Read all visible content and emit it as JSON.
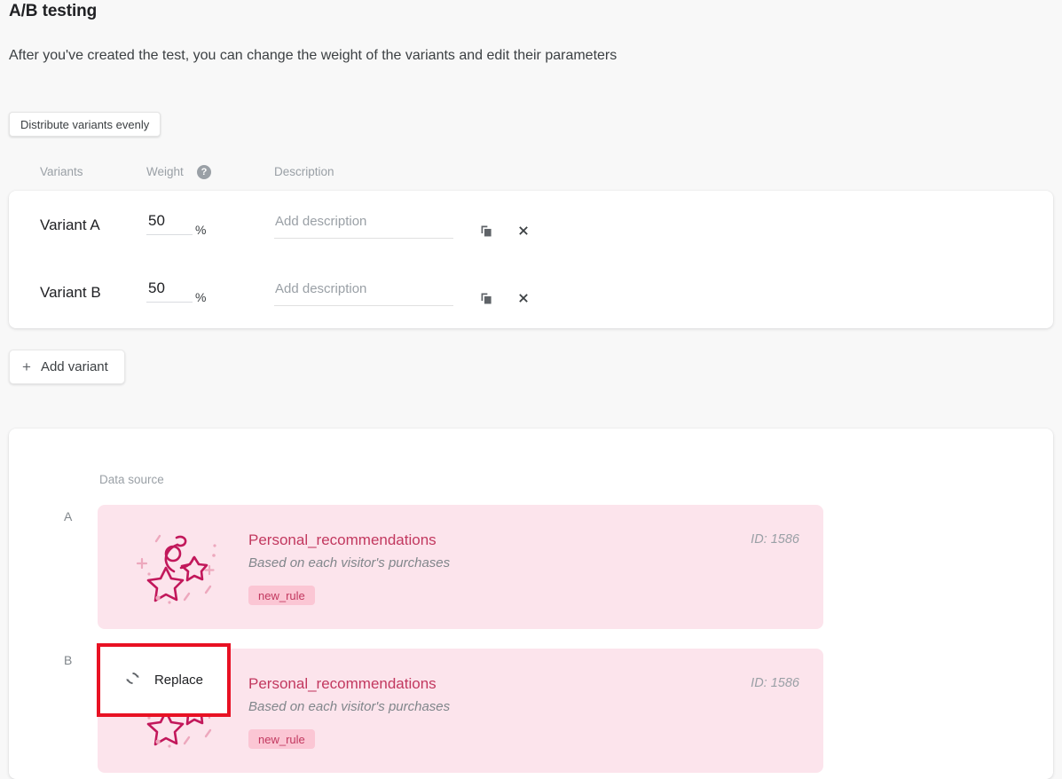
{
  "header": {
    "title": "A/B testing",
    "subtitle": "After you've created the test, you can change the weight of the variants and edit their parameters"
  },
  "toolbar": {
    "distribute_label": "Distribute variants evenly"
  },
  "table": {
    "columns": {
      "variants": "Variants",
      "weight": "Weight",
      "description": "Description"
    },
    "weight_help_glyph": "?",
    "percent_sign": "%",
    "rows": [
      {
        "name": "Variant A",
        "weight": "50",
        "description_value": "",
        "description_placeholder": "Add description",
        "duplicate_icon": "copy-icon",
        "delete_icon": "close-icon"
      },
      {
        "name": "Variant B",
        "weight": "50",
        "description_value": "",
        "description_placeholder": "Add description",
        "duplicate_icon": "copy-icon",
        "delete_icon": "close-icon"
      }
    ]
  },
  "add_variant": {
    "plus_glyph": "+",
    "label": "Add variant"
  },
  "data_source": {
    "label": "Data source",
    "items": [
      {
        "letter": "A",
        "title": "Personal_recommendations",
        "subtitle": "Based on each visitor's purchases",
        "tag": "new_rule",
        "id": "ID: 1586",
        "illustration_icon": "magic-wand-stars-icon"
      },
      {
        "letter": "B",
        "title": "Personal_recommendations",
        "subtitle": "Based on each visitor's purchases",
        "tag": "new_rule",
        "id": "ID: 1586",
        "illustration_icon": "magic-wand-stars-icon"
      }
    ]
  },
  "replace_overlay": {
    "label": "Replace",
    "icon": "sync-refresh-icon",
    "highlight_color": "#e81123"
  },
  "colors": {
    "page_background": "#f8f8f8",
    "card_background": "#ffffff",
    "accent_rose": "#c2385f",
    "card_rose_background": "#fce4ec",
    "tag_background": "#fbc6d4",
    "muted_text": "#9aa0a6",
    "primary_text": "#202124",
    "annotation_red": "#e81123"
  }
}
